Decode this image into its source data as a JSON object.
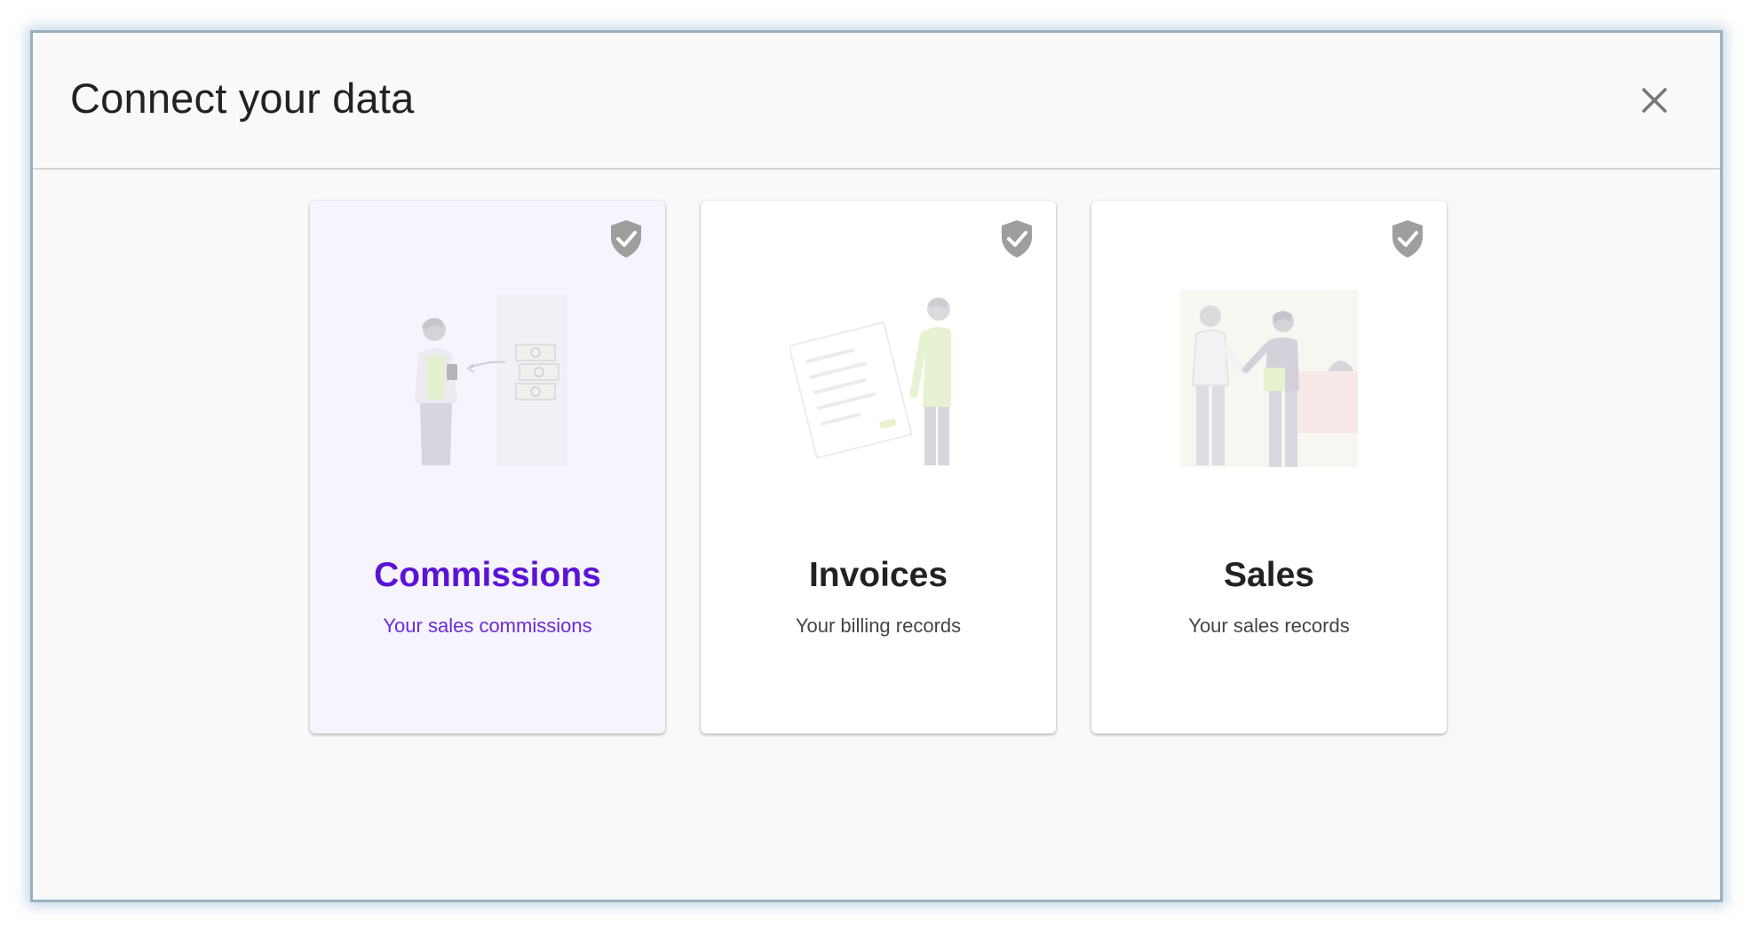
{
  "dialog": {
    "title": "Connect your data",
    "close_icon": "close-icon"
  },
  "cards": [
    {
      "title": "Commissions",
      "description": "Your sales commissions",
      "selected": true,
      "badge_icon": "shield-check-icon",
      "illustration": "commissions-illustration"
    },
    {
      "title": "Invoices",
      "description": "Your billing records",
      "selected": false,
      "badge_icon": "shield-check-icon",
      "illustration": "invoices-illustration"
    },
    {
      "title": "Sales",
      "description": "Your sales records",
      "selected": false,
      "badge_icon": "shield-check-icon",
      "illustration": "sales-illustration"
    }
  ],
  "colors": {
    "accent": "#5b13d6",
    "selected_card_bg": "#f6f4fc",
    "badge_gray": "#9e9e9e"
  }
}
